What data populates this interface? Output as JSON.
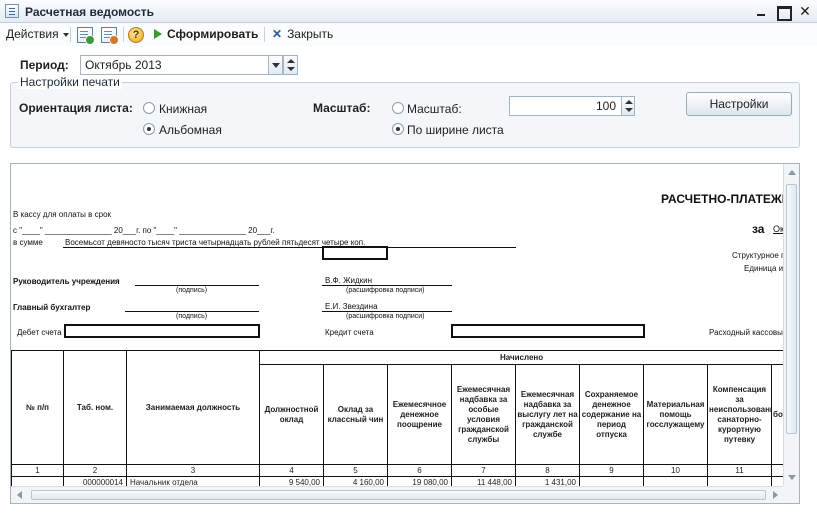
{
  "window": {
    "title": "Расчетная ведомость"
  },
  "toolbar": {
    "actions_label": "Действия",
    "form_label": "Сформировать",
    "close_label": "Закрыть",
    "help_glyph": "?"
  },
  "period": {
    "label": "Период:",
    "value": "Октябрь 2013"
  },
  "print_settings": {
    "group_title": "Настройки печати",
    "orientation_label": "Ориентация листа:",
    "orientation_options": [
      "Книжная",
      "Альбомная"
    ],
    "orientation_selected": "Альбомная",
    "scale_label": "Масштаб:",
    "scale_options": [
      "Масштаб:",
      "По ширине листа"
    ],
    "scale_selected": "По ширине листа",
    "scale_value": "100",
    "settings_button": "Настройки"
  },
  "document": {
    "title": "РАСЧЕТНО-ПЛАТЕЖН",
    "za_label": "за",
    "za_value": "Ок",
    "cashbox_text": "В кассу для оплаты в срок",
    "dates_line": "с \"____\" _______________ 20___г. по \"____\" _______________ 20___г.",
    "sum_label": "в сумме",
    "sum_words": "Восемьсот девяносто тысяч триста четырнадцать рублей пятьдесят четыре коп.",
    "struct_unit": "Структурное по",
    "unit_measure": "Единица изм",
    "head_label": "Руководитель учреждения",
    "head_sign_hint": "(подпись)",
    "head_name": "В.Ф. Жидкин",
    "head_name_hint": "(расшифровка подписи)",
    "accountant_label": "Главный бухгалтер",
    "accountant_sign_hint": "(подпись)",
    "accountant_name": "Е.И. Звездина",
    "accountant_name_hint": "(расшифровка подписи)",
    "debit_label": "Дебет счета",
    "credit_label": "Кредит счета",
    "expense_label": "Расходный кассовый",
    "table": {
      "accrued_header": "Начислено",
      "columns": [
        "№ п/п",
        "Таб. ном.",
        "Занимаемая должность",
        "Должностной оклад",
        "Оклад за классный чин",
        "Ежемесячное денежное поощрение",
        "Ежемесячная надбавка за особые условия гражданской службы",
        "Ежемесячная надбавка за выслугу лет на гражданской службе",
        "Сохраняемое денежное содержание на период отпуска",
        "Материальная помощь госслужащему",
        "Компенсация за неиспользованную санаторно-курортную путевку",
        "бо"
      ],
      "column_numbers": [
        "1",
        "2",
        "3",
        "4",
        "5",
        "6",
        "7",
        "8",
        "9",
        "10",
        "11",
        ""
      ],
      "rows": [
        [
          "",
          "000000014",
          "Начальник отдела",
          "9 540,00",
          "4 160,00",
          "19 080,00",
          "11 448,00",
          "1 431,00",
          "",
          "",
          "",
          ""
        ]
      ]
    }
  }
}
